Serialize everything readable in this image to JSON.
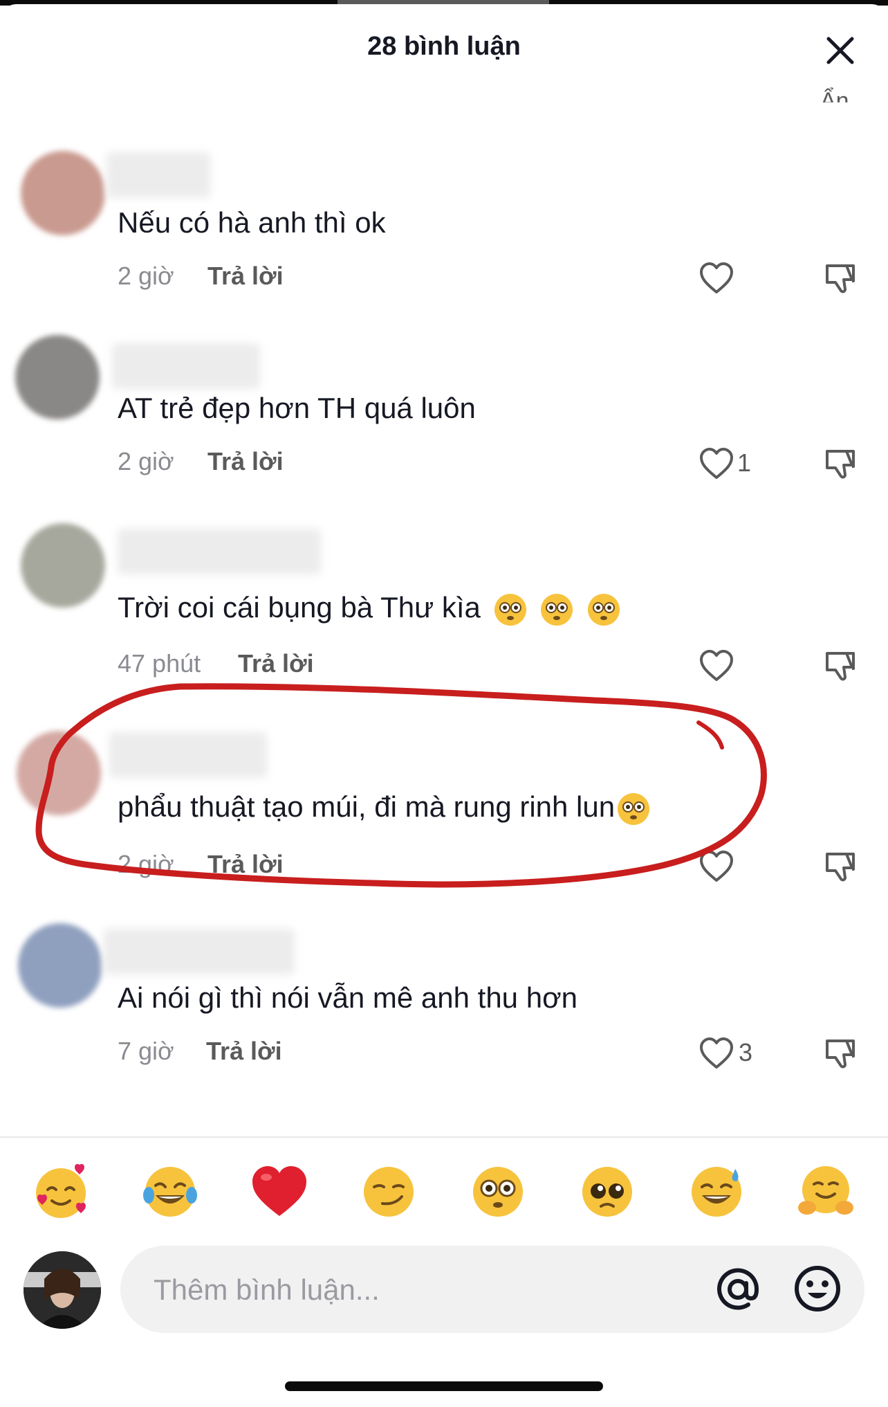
{
  "header": {
    "title": "28 bình luận",
    "hide_label": "Ẩn"
  },
  "comments": [
    {
      "text": "Nếu có hà anh thì ok",
      "time": "2 giờ",
      "reply": "Trả lời",
      "likes": "",
      "avatar_color": "#c99a8f"
    },
    {
      "text": "AT trẻ đẹp hơn TH quá luôn",
      "time": "2 giờ",
      "reply": "Trả lời",
      "likes": "1",
      "avatar_color": "#8a8886"
    },
    {
      "text": "Trời coi cái bụng bà Thư kìa",
      "time": "47 phút",
      "reply": "Trả lời",
      "likes": "",
      "avatar_color": "#a7a89d"
    },
    {
      "text": "phẩu thuật tạo múi, đi mà rung rinh lun",
      "time": "2 giờ",
      "reply": "Trả lời",
      "likes": "",
      "avatar_color": "#d4a9a3"
    },
    {
      "text": "Ai nói gì thì nói vẫn mê anh thu hơn",
      "time": "7 giờ",
      "reply": "Trả lời",
      "likes": "3",
      "avatar_color": "#8fa0bf"
    }
  ],
  "emoji_bar": [
    "🥰",
    "😂",
    "❤️",
    "😏",
    "😳",
    "🥺",
    "😅",
    "🤗"
  ],
  "composer": {
    "placeholder": "Thêm bình luận..."
  },
  "icons": [
    "close-icon",
    "heart-icon",
    "dislike-icon",
    "at-icon",
    "smile-icon"
  ],
  "colors": {
    "annotation": "#c81e1e",
    "text": "#161823",
    "muted": "#8a8b91"
  }
}
